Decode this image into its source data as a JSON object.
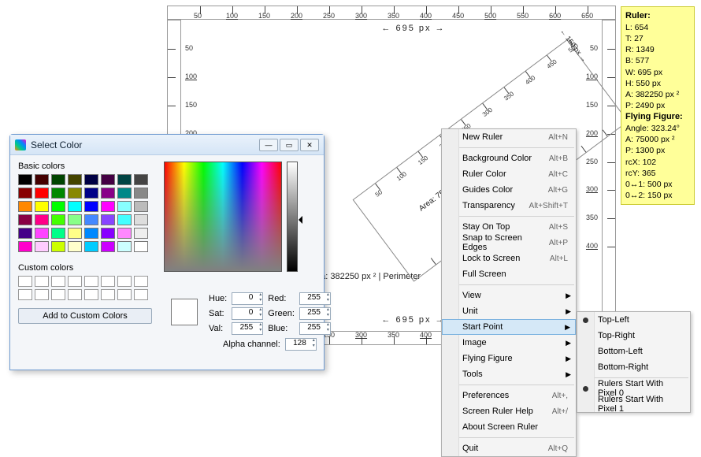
{
  "ruler": {
    "ticks_top": [
      50,
      100,
      150,
      200,
      250,
      300,
      350,
      400,
      450,
      500,
      550,
      600,
      650
    ],
    "ticks_side": [
      50,
      100,
      150,
      200,
      250,
      300,
      350,
      400
    ],
    "width_label": "← 695 px →",
    "stats": "Area: 382250 px ² | Perimeter"
  },
  "flying": {
    "mid": "Area: 75000 px ² | Perimeter: 1300 px",
    "side": "← 150 px →"
  },
  "info": {
    "h1": "Ruler:",
    "L": "L: 654",
    "T": "T: 27",
    "R": "R: 1349",
    "B": "B: 577",
    "W": "W: 695 px",
    "H": "H: 550 px",
    "A": "A: 382250 px ²",
    "P": "P: 2490 px",
    "h2": "Flying Figure:",
    "Angle": "Angle: 323.24°",
    "A2": "A: 75000 px ²",
    "P2": "P: 1300 px",
    "rcX": "rcX: 102",
    "rcY": "rcY: 365",
    "d1": "0↔1: 500 px",
    "d2": "0↔2: 150 px"
  },
  "menu": {
    "items": [
      {
        "label": "New Ruler",
        "sc": "Alt+N"
      },
      {
        "sep": true
      },
      {
        "label": "Background Color",
        "sc": "Alt+B"
      },
      {
        "label": "Ruler Color",
        "sc": "Alt+C"
      },
      {
        "label": "Guides Color",
        "sc": "Alt+G"
      },
      {
        "label": "Transparency",
        "sc": "Alt+Shift+T"
      },
      {
        "sep": true
      },
      {
        "label": "Stay On Top",
        "sc": "Alt+S"
      },
      {
        "label": "Snap to Screen Edges",
        "sc": "Alt+P"
      },
      {
        "label": "Lock to Screen",
        "sc": "Alt+L"
      },
      {
        "label": "Full Screen",
        "sc": ""
      },
      {
        "sep": true
      },
      {
        "label": "View",
        "sub": true
      },
      {
        "label": "Unit",
        "sub": true
      },
      {
        "label": "Start Point",
        "sub": true,
        "hi": true
      },
      {
        "label": "Image",
        "sub": true
      },
      {
        "label": "Flying Figure",
        "sub": true
      },
      {
        "label": "Tools",
        "sub": true
      },
      {
        "sep": true
      },
      {
        "label": "Preferences",
        "sc": "Alt+,"
      },
      {
        "label": "Screen Ruler Help",
        "sc": "Alt+/"
      },
      {
        "label": "About Screen Ruler",
        "sc": ""
      },
      {
        "sep": true
      },
      {
        "label": "Quit",
        "sc": "Alt+Q"
      }
    ],
    "sub": [
      {
        "label": "Top-Left",
        "sel": true
      },
      {
        "label": "Top-Right"
      },
      {
        "label": "Bottom-Left"
      },
      {
        "label": "Bottom-Right"
      },
      {
        "sep": true
      },
      {
        "label": "Rulers Start With Pixel 0",
        "sel": true
      },
      {
        "label": "Rulers Start With Pixel 1"
      }
    ]
  },
  "dlg": {
    "title": "Select Color",
    "basic_label": "Basic colors",
    "custom_label": "Custom colors",
    "add_btn": "Add to Custom Colors",
    "fields": {
      "hue_l": "Hue:",
      "hue": "0",
      "sat_l": "Sat:",
      "sat": "0",
      "val_l": "Val:",
      "val": "255",
      "red_l": "Red:",
      "red": "255",
      "green_l": "Green:",
      "green": "255",
      "blue_l": "Blue:",
      "blue": "255",
      "alpha_l": "Alpha channel:",
      "alpha": "128"
    },
    "colors": [
      "#000",
      "#400",
      "#040",
      "#440",
      "#004",
      "#404",
      "#044",
      "#444",
      "#800",
      "#f00",
      "#080",
      "#880",
      "#008",
      "#808",
      "#088",
      "#888",
      "#f80",
      "#ff0",
      "#0f0",
      "#0ff",
      "#00f",
      "#f0f",
      "#8ff",
      "#bbb",
      "#804",
      "#f08",
      "#4f0",
      "#8f8",
      "#48f",
      "#84f",
      "#4ff",
      "#ddd",
      "#408",
      "#f4f",
      "#0f8",
      "#ff8",
      "#08f",
      "#80f",
      "#f8f",
      "#eee",
      "#f0c",
      "#fcf",
      "#cf0",
      "#ffc",
      "#0cf",
      "#c0f",
      "#cff",
      "#fff"
    ]
  }
}
